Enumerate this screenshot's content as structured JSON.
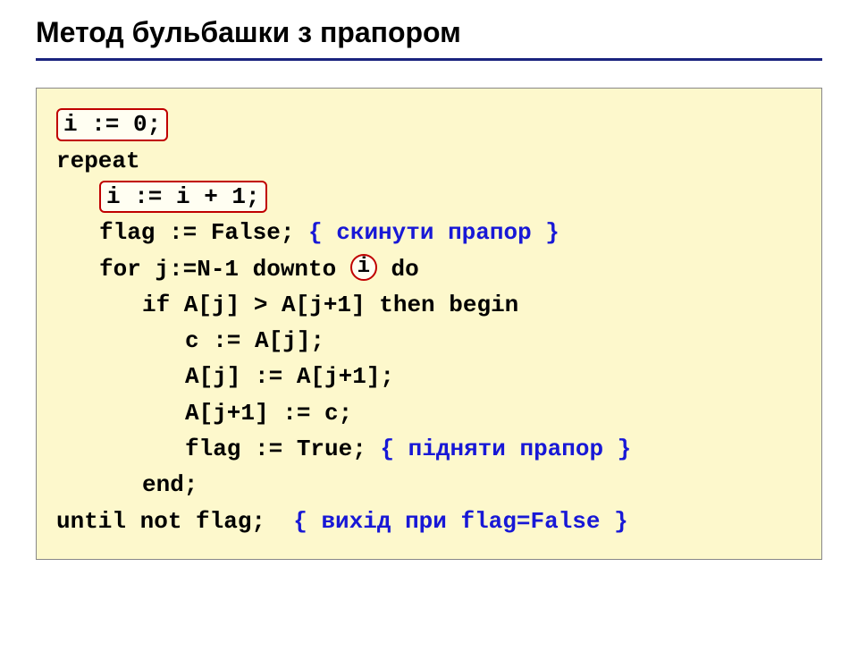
{
  "title": "Метод бульбашки з прапором",
  "code": {
    "line1_box": "i := 0;",
    "line2": "repeat",
    "line3_box": "i := i + 1;",
    "line4_pre": "flag := False; ",
    "line4_comment": "{ скинути прапор }",
    "line5_pre": "for j:=N-1 downto ",
    "line5_i": "i",
    "line5_post": " do",
    "line6": "if A[j] > A[j+1] then begin",
    "line7": "с := A[j];",
    "line8": "A[j] := A[j+1];",
    "line9": "A[j+1] := с;",
    "line10_pre": "flag := True; ",
    "line10_comment": "{ підняти прапор }",
    "line11": "end;",
    "line12_pre": "until not flag;  ",
    "line12_comment": "{ вихід при flag=False }"
  }
}
